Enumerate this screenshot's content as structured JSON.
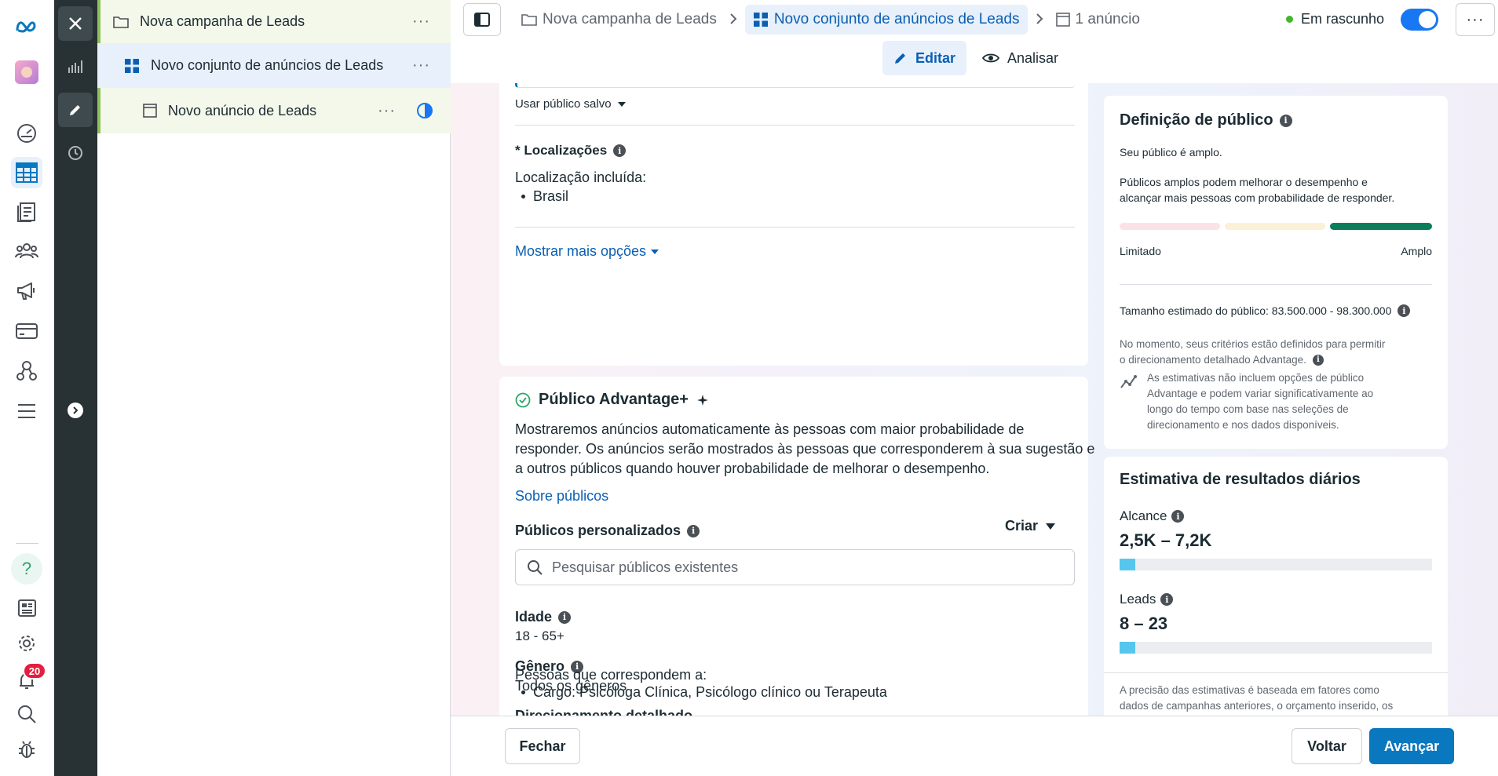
{
  "tree": {
    "campaign": "Nova campanha de Leads",
    "adset": "Novo conjunto de anúncios de Leads",
    "ad": "Novo anúncio de Leads",
    "more": "···"
  },
  "nav": {
    "notifications_count": "20"
  },
  "header": {
    "breadcrumb_campaign": "Nova campanha de Leads",
    "breadcrumb_adset": "Novo conjunto de anúncios de Leads",
    "breadcrumb_ads": "1 anúncio",
    "status": "Em rascunho",
    "more": "···",
    "edit_label": "Editar",
    "review_label": "Analisar"
  },
  "audience": {
    "saved_audience_label": "Usar público salvo",
    "locations_title": "* Localizações",
    "location_included_label": "Localização incluída:",
    "location_value": "Brasil",
    "show_more_label": "Mostrar mais opções",
    "advantage_title": "Público Advantage+",
    "advantage_desc_1": "Mostraremos anúncios automaticamente às pessoas com maior probabilidade de",
    "advantage_desc_2": "responder. Os anúncios serão mostrados às pessoas que corresponderem à sua sugestão e",
    "advantage_desc_3": "a outros públicos quando houver probabilidade de melhorar o desempenho.",
    "about_audiences_link": "Sobre públicos",
    "custom_audiences_title": "Públicos personalizados",
    "create_label": "Criar",
    "search_placeholder": "Pesquisar públicos existentes",
    "age_title": "Idade",
    "age_value": "18 - 65+",
    "gender_title": "Gênero",
    "gender_value": "Todos os gêneros",
    "detailed_targeting_title": "Direcionamento detalhado",
    "detailed_targeting_label": "Pessoas que correspondem a:",
    "detailed_targeting_value": "Cargo: Psicóloga Clínica, Psicólogo clínico ou Terapeuta"
  },
  "definition": {
    "title": "Definição de público",
    "summary": "Seu público é amplo.",
    "desc_1": "Públicos amplos podem melhorar o desempenho e",
    "desc_2": "alcançar mais pessoas com probabilidade de responder.",
    "meter_low": "Limitado",
    "meter_high": "Amplo",
    "meter_level": "broad",
    "estimated_size": "Tamanho estimado do público: 83.500.000 - 98.300.000",
    "criteria_1": "No momento, seus critérios estão definidos para permitir",
    "criteria_2": "o direcionamento detalhado Advantage.",
    "note_1": "As estimativas não incluem opções de público",
    "note_2": "Advantage e podem variar significativamente ao",
    "note_3": "longo do tempo com base nas seleções de",
    "note_4": "direcionamento e nos dados disponíveis."
  },
  "daily_results": {
    "title": "Estimativa de resultados diários",
    "reach_label": "Alcance",
    "reach_value": "2,5K – 7,2K",
    "reach_fill": 0.05,
    "leads_label": "Leads",
    "leads_value": "8 – 23",
    "leads_fill": 0.05,
    "footnote_1": "A precisão das estimativas é baseada em fatores como",
    "footnote_2": "dados de campanhas anteriores, o orçamento inserido, os"
  },
  "footer": {
    "close_label": "Fechar",
    "back_label": "Voltar",
    "next_label": "Avançar"
  },
  "colors": {
    "accent": "#0a78be",
    "link": "#0a5fb3",
    "status_green": "#42b72a",
    "meter_good": "#0b7d5b"
  }
}
